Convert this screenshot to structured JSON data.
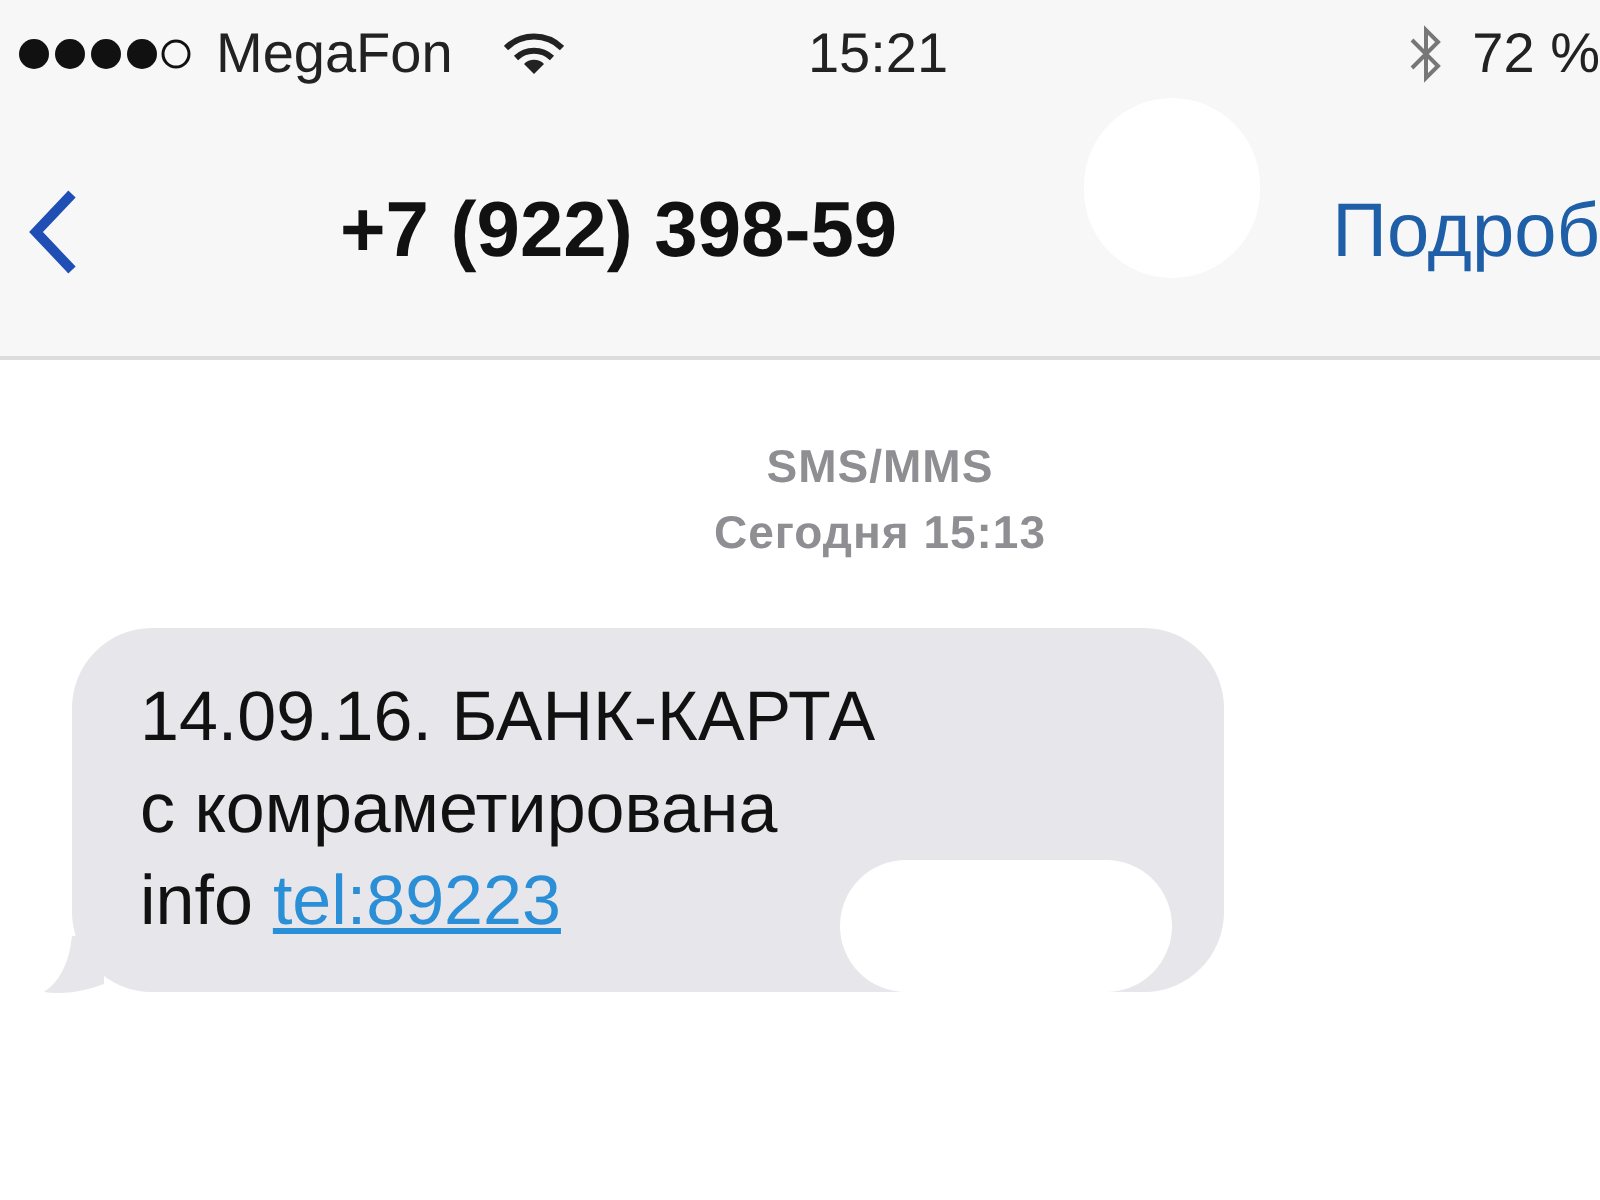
{
  "status_bar": {
    "carrier": "MegaFon",
    "time": "15:21",
    "battery": "72 %"
  },
  "header": {
    "title": "+7 (922) 398-59",
    "details": "Подроб"
  },
  "thread": {
    "service": "SMS/MMS",
    "timestamp": "Сегодня 15:13"
  },
  "messages": [
    {
      "lines": [
        "14.09.16. БАНК-КАРТА",
        "с комраметирована"
      ],
      "prefix": "info",
      "link": "tel:89223"
    }
  ]
}
